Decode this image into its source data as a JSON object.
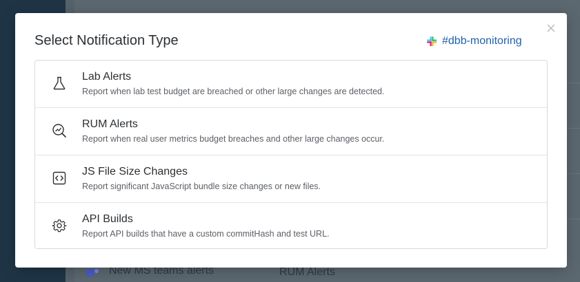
{
  "modal": {
    "title": "Select Notification Type",
    "channel": "#dbb-monitoring",
    "close_icon": "close-icon",
    "options": [
      {
        "icon": "flask-icon",
        "title": "Lab Alerts",
        "description": "Report when lab test budget are breached or other large changes are detected."
      },
      {
        "icon": "magnifier-chart-icon",
        "title": "RUM Alerts",
        "description": "Report when real user metrics budget breaches and other large changes occur."
      },
      {
        "icon": "code-file-icon",
        "title": "JS File Size Changes",
        "description": "Report significant JavaScript bundle size changes or new files."
      },
      {
        "icon": "gear-icon",
        "title": "API Builds",
        "description": "Report API builds that have a custom commitHash and test URL."
      }
    ]
  },
  "background": {
    "row": {
      "name": "New MS teams alerts",
      "type": "RUM Alerts"
    }
  },
  "colors": {
    "accent": "#2060a8",
    "overlay": "#56626b"
  }
}
